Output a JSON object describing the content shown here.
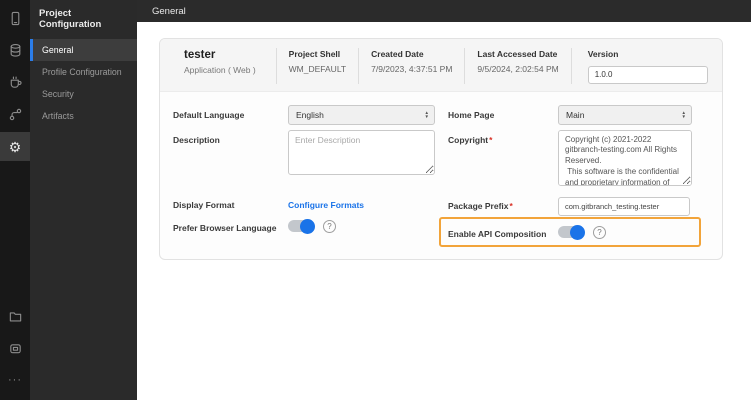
{
  "colors": {
    "accent_blue": "#1a73e8",
    "active_nav_blue": "#2b7de9",
    "highlight_orange": "#f2a43a",
    "required_red": "#d93025",
    "rail_bg": "#181818",
    "sidebar_bg": "#2a2a2a",
    "topbar_bg": "#2b2b2b"
  },
  "icons": {
    "rail_top": [
      "mobile-icon",
      "database-icon",
      "coffee-icon",
      "flow-icon",
      "settings-icon"
    ],
    "rail_bottom": [
      "folder-icon",
      "package-icon",
      "more-icon"
    ],
    "settings_glyph": "⚙",
    "more_glyph": "···",
    "help_glyph": "?",
    "arrow_up": "▲",
    "arrow_down": "▼"
  },
  "sidebar": {
    "title": "Project Configuration",
    "items": [
      {
        "label": "General",
        "active": true
      },
      {
        "label": "Profile Configuration",
        "active": false
      },
      {
        "label": "Security",
        "active": false
      },
      {
        "label": "Artifacts",
        "active": false
      }
    ]
  },
  "topbar": {
    "title": "General"
  },
  "project_card": {
    "name": "tester",
    "type": "Application ( Web )",
    "fields": [
      {
        "label": "Project Shell",
        "value": "WM_DEFAULT"
      },
      {
        "label": "Created Date",
        "value": "7/9/2023, 4:37:51 PM"
      },
      {
        "label": "Last Accessed Date",
        "value": "9/5/2024, 2:02:54 PM"
      }
    ],
    "version": {
      "label": "Version",
      "value": "1.0.0"
    }
  },
  "form": {
    "required_marker": "*",
    "default_language": {
      "label": "Default Language",
      "value": "English"
    },
    "home_page": {
      "label": "Home Page",
      "value": "Main"
    },
    "description": {
      "label": "Description",
      "placeholder": "Enter Description",
      "value": ""
    },
    "copyright": {
      "label": "Copyright",
      "required": true,
      "value": "Copyright (c) 2021-2022 gitbranch-testing.com All Rights Reserved.\n This software is the confidential and proprietary information of gitbranch"
    },
    "display_format": {
      "label": "Display Format",
      "link_label": "Configure Formats"
    },
    "package_prefix": {
      "label": "Package Prefix",
      "required": true,
      "value": "com.gitbranch_testing.tester"
    },
    "prefer_browser_language": {
      "label": "Prefer Browser Language",
      "enabled": true
    },
    "enable_api_composition": {
      "label": "Enable API Composition",
      "enabled": true,
      "highlighted": true
    }
  }
}
